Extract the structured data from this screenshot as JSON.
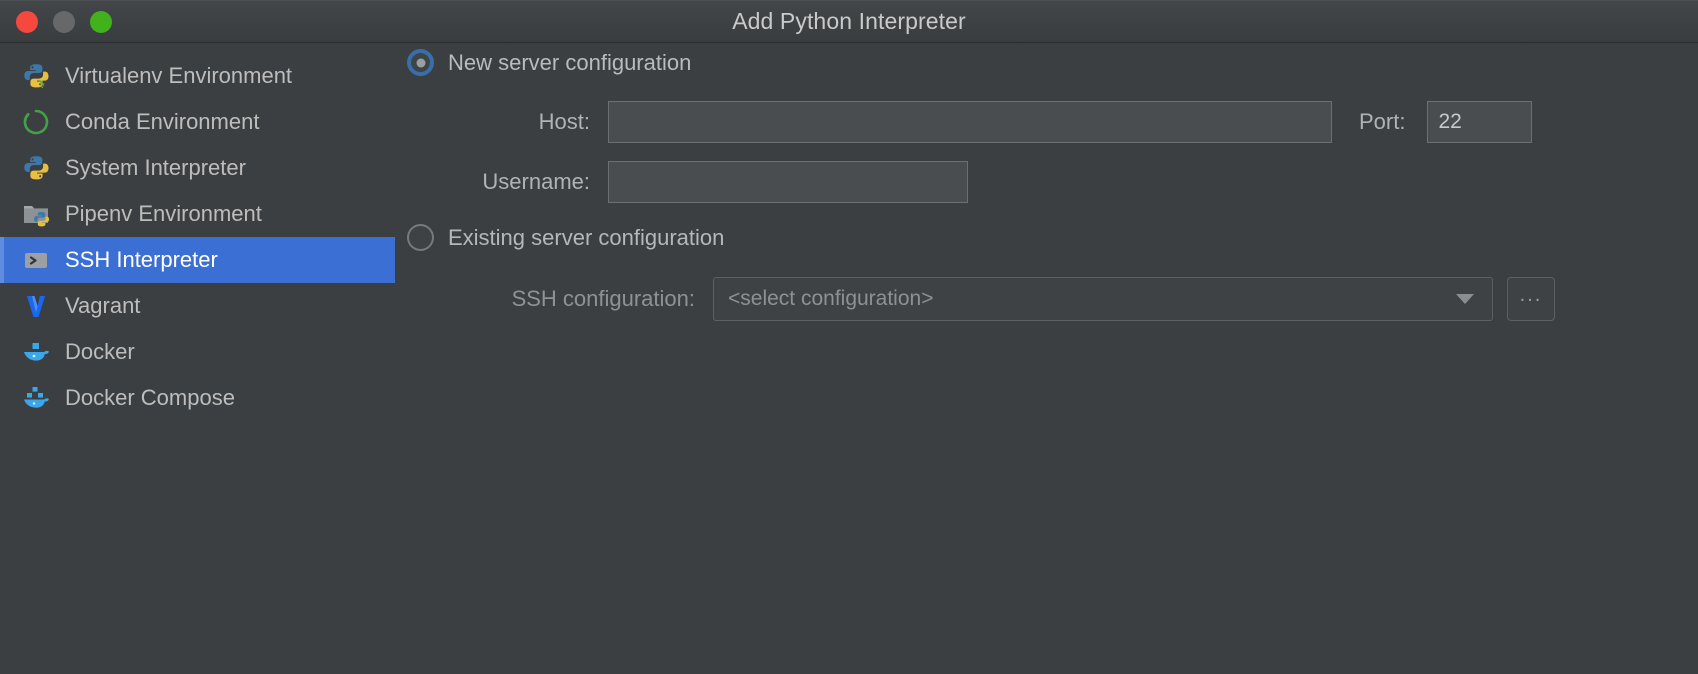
{
  "window": {
    "title": "Add Python Interpreter",
    "traffic_lights": [
      "close",
      "minimize",
      "maximize"
    ],
    "colors": {
      "close": "#f6483e",
      "minimize": "#66686a",
      "maximize": "#41b21b",
      "background": "#3c3f41",
      "selection": "#3b6fd4",
      "field_background": "#4a4d4f",
      "text": "#bbbbbb"
    }
  },
  "sidebar": {
    "items": [
      {
        "label": "Virtualenv Environment",
        "icon": "python-venv-icon",
        "selected": false
      },
      {
        "label": "Conda Environment",
        "icon": "conda-icon",
        "selected": false
      },
      {
        "label": "System Interpreter",
        "icon": "python-icon",
        "selected": false
      },
      {
        "label": "Pipenv Environment",
        "icon": "pipenv-folder-icon",
        "selected": false
      },
      {
        "label": "SSH Interpreter",
        "icon": "ssh-terminal-icon",
        "selected": true
      },
      {
        "label": "Vagrant",
        "icon": "vagrant-icon",
        "selected": false
      },
      {
        "label": "Docker",
        "icon": "docker-icon",
        "selected": false
      },
      {
        "label": "Docker Compose",
        "icon": "docker-compose-icon",
        "selected": false
      }
    ]
  },
  "main": {
    "new_server": {
      "radio_label": "New server configuration",
      "selected": true,
      "host": {
        "label": "Host:",
        "value": "",
        "placeholder": ""
      },
      "port": {
        "label": "Port:",
        "value": "22"
      },
      "username": {
        "label": "Username:",
        "value": "",
        "placeholder": ""
      }
    },
    "existing_server": {
      "radio_label": "Existing server configuration",
      "selected": false,
      "ssh_configuration": {
        "label": "SSH configuration:",
        "value": "<select configuration>",
        "dropdown_icon": "chevron-down-icon",
        "browse_label": "..."
      }
    }
  }
}
